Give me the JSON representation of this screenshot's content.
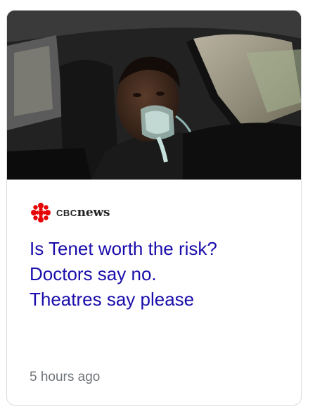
{
  "card": {
    "source": {
      "prefix": "CBC",
      "name": "news",
      "logo": "cbc-gem-icon",
      "brand_color": "#e60505"
    },
    "headline": "Is Tenet worth the risk?\nDoctors say no.\nTheatres say please",
    "timestamp": "5 hours ago",
    "link_color": "#1a0dab",
    "meta_color": "#70757a"
  }
}
